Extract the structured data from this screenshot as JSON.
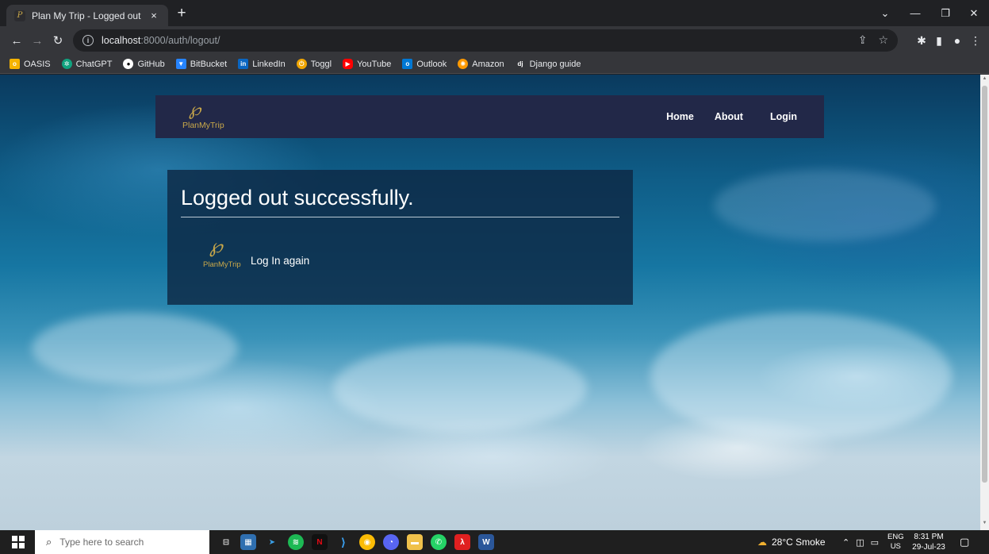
{
  "browser": {
    "tab_title": "Plan My Trip - Logged out",
    "tab_close": "×",
    "new_tab": "+",
    "url_host": "localhost",
    "url_rest": ":8000/auth/logout/",
    "bookmarks": [
      {
        "label": "OASIS",
        "icon": "oasis-icon",
        "color": "#f5b301"
      },
      {
        "label": "ChatGPT",
        "icon": "chatgpt-icon",
        "color": "#10a37f"
      },
      {
        "label": "GitHub",
        "icon": "github-icon",
        "color": "#ffffff"
      },
      {
        "label": "BitBucket",
        "icon": "bitbucket-icon",
        "color": "#2684ff"
      },
      {
        "label": "LinkedIn",
        "icon": "linkedin-icon",
        "color": "#0a66c2"
      },
      {
        "label": "Toggl",
        "icon": "toggl-icon",
        "color": "#e57cd8"
      },
      {
        "label": "YouTube",
        "icon": "youtube-icon",
        "color": "#ff0000"
      },
      {
        "label": "Outlook",
        "icon": "outlook-icon",
        "color": "#0078d4"
      },
      {
        "label": "Amazon",
        "icon": "amazon-icon",
        "color": "#ff9900"
      },
      {
        "label": "Django guide",
        "icon": "django-icon",
        "color": "#092e20"
      }
    ]
  },
  "site": {
    "brand_text": "PlanMyTrip",
    "nav": {
      "home": "Home",
      "about": "About",
      "login": "Login"
    }
  },
  "card": {
    "title": "Logged out successfully.",
    "logo_text": "PlanMyTrip",
    "link_text": "Log In again"
  },
  "taskbar": {
    "search_placeholder": "Type here to search",
    "weather": "28°C  Smoke",
    "lang_top": "ENG",
    "lang_bottom": "US",
    "time": "8:31 PM",
    "date": "29-Jul-23"
  },
  "colors": {
    "nav_bg": "#222848",
    "brand_gold": "#c9a84a",
    "card_bg": "#0e2844"
  }
}
